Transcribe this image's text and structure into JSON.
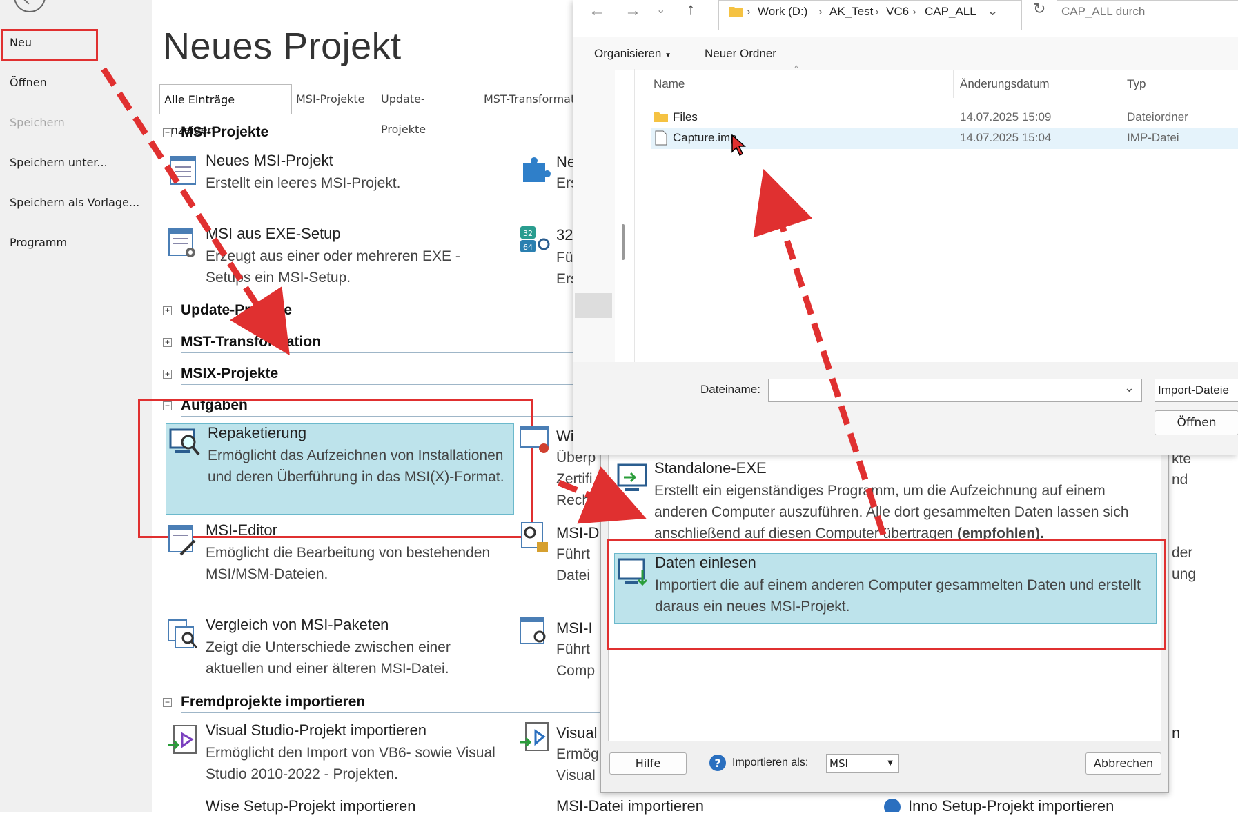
{
  "sidebar": {
    "items": [
      {
        "label": "Neu",
        "disabled": false
      },
      {
        "label": "Öffnen",
        "disabled": false
      },
      {
        "label": "Speichern",
        "disabled": true
      },
      {
        "label": "Speichern unter...",
        "disabled": false
      },
      {
        "label": "Speichern als Vorlage...",
        "disabled": false
      },
      {
        "label": "Programm",
        "disabled": false
      }
    ]
  },
  "main": {
    "title": "Neues Projekt",
    "tabs": [
      "Alle Einträge anzeigen",
      "MSI-Projekte",
      "Update-Projekte",
      "MST-Transformat"
    ],
    "sections": {
      "msi": "MSI-Projekte",
      "update": "Update-Projekte",
      "mst": "MST-Transformation",
      "msix": "MSIX-Projekte",
      "aufgaben": "Aufgaben",
      "fremd": "Fremdprojekte importieren"
    },
    "entries": {
      "neues_msi": {
        "title": "Neues MSI-Projekt",
        "desc": "Erstellt ein leeres MSI-Projekt."
      },
      "msi_exe": {
        "title": "MSI aus EXE-Setup",
        "desc": "Erzeugt aus einer oder mehreren EXE - Setups ein MSI-Setup."
      },
      "repak": {
        "title": "Repaketierung",
        "desc": "Ermöglicht das Aufzeichnen von Installationen und deren Überführung in das MSI(X)-Format."
      },
      "editor": {
        "title": "MSI-Editor",
        "desc": "Emöglicht die Bearbeitung von bestehenden MSI/MSM-Dateien."
      },
      "vergleich": {
        "title": "Vergleich von MSI-Paketen",
        "desc": "Zeigt die Unterschiede zwischen einer aktuellen und einer älteren MSI-Datei."
      },
      "vs": {
        "title": "Visual Studio-Projekt importieren",
        "desc": "Ermöglicht den Import von VB6- sowie Visual Studio 2010-2022 - Projekten."
      },
      "wise": {
        "title": "Wise Setup-Projekt importieren"
      }
    },
    "col2": {
      "ne": {
        "title": "Ne",
        "desc": "Ers"
      },
      "x32": {
        "title": "32",
        "l1": "Fü",
        "l2": "Ers"
      },
      "wi": {
        "title": "Wi",
        "l1": "Überp",
        "l2": "Zertifi",
        "l3": "Rechn"
      },
      "msid": {
        "title": "MSI-D",
        "l1": "Führt",
        "l2": "Datei"
      },
      "msii": {
        "title": "MSI-I",
        "l1": "Führt",
        "l2": "Comp"
      },
      "visual": {
        "title": "Visual",
        "l1": "Ermög",
        "l2": "Visual"
      },
      "msidatei": {
        "title": "MSI-Datei importieren"
      },
      "kte": "kte",
      "nd": "nd",
      "der": "der",
      "ung": "ung",
      "n": "n",
      "inno": "Inno Setup-Projekt importieren"
    }
  },
  "dialog": {
    "entries": {
      "standalone": {
        "title": "Standalone-EXE",
        "desc": "Erstellt ein eigenständiges Programm, um die Aufzeichnung auf einem anderen Computer auszuführen. Alle dort gesammelten Daten lassen sich anschließend auf diesen Computer übertragen ",
        "bold": "(empfohlen)."
      },
      "daten": {
        "title": "Daten einlesen",
        "desc": "Importiert die auf einem anderen Computer gesammelten Daten und erstellt daraus ein neues MSI-Projekt."
      }
    },
    "help_button": "Hilfe",
    "import_label": "Importieren als:",
    "import_value": "MSI",
    "cancel_button": "Abbrechen"
  },
  "filedialog": {
    "breadcrumb": [
      "Work (D:)",
      "AK_Test",
      "VC6",
      "CAP_ALL"
    ],
    "search_placeholder": "CAP_ALL durch",
    "toolbar": {
      "organize": "Organisieren",
      "new_folder": "Neuer Ordner"
    },
    "columns": {
      "name": "Name",
      "date": "Änderungsdatum",
      "type": "Typ"
    },
    "files": [
      {
        "name": "Files",
        "date": "14.07.2025 15:09",
        "type": "Dateiordner",
        "kind": "folder"
      },
      {
        "name": "Capture.imp",
        "date": "14.07.2025 15:04",
        "type": "IMP-Datei",
        "kind": "file"
      }
    ],
    "filename_label": "Dateiname:",
    "filename_value": "",
    "filter_value": "Import-Dateie",
    "open_button": "Öffnen"
  },
  "colors": {
    "highlight": "#bde3eb",
    "highlight_border": "#6bb9cc",
    "annotation_red": "#e03030",
    "sidebar_bg": "#f0f0f0"
  }
}
